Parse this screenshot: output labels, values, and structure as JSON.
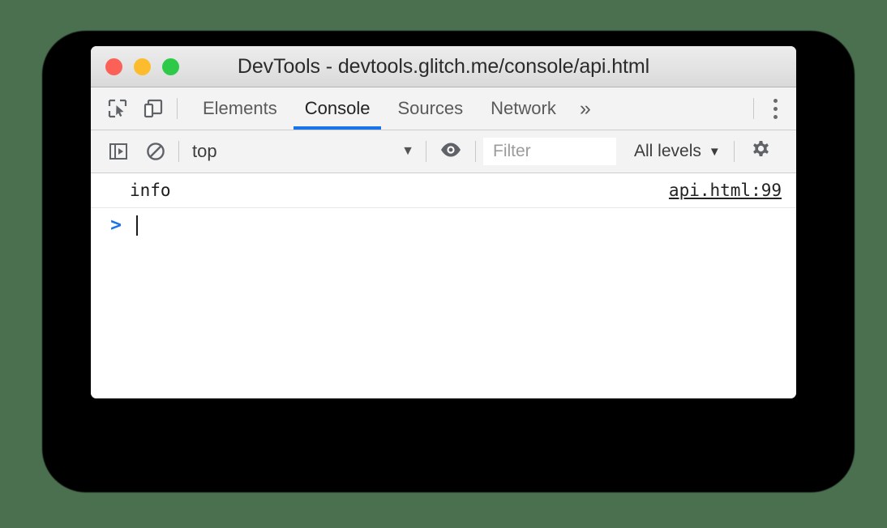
{
  "window": {
    "title": "DevTools - devtools.glitch.me/console/api.html",
    "traffic_lights": [
      {
        "name": "close",
        "color": "#fc6158"
      },
      {
        "name": "minimize",
        "color": "#fdbc2e"
      },
      {
        "name": "maximize",
        "color": "#2fc94a"
      }
    ]
  },
  "tabbar": {
    "icons": [
      {
        "name": "inspect-element-icon"
      },
      {
        "name": "device-toolbar-icon"
      }
    ],
    "tabs": [
      {
        "label": "Elements",
        "active": false
      },
      {
        "label": "Console",
        "active": true
      },
      {
        "label": "Sources",
        "active": false
      },
      {
        "label": "Network",
        "active": false
      }
    ],
    "more_tabs_label": "»",
    "menu_icon": "kebab-menu-icon",
    "active_underline_color": "#1a73e8"
  },
  "console_toolbar": {
    "sidebar_toggle_icon": "show-console-sidebar-icon",
    "clear_console_icon": "clear-console-icon",
    "context": {
      "value": "top",
      "caret": "▼"
    },
    "live_expression_icon": "eye-icon",
    "filter": {
      "value": "",
      "placeholder": "Filter"
    },
    "levels": {
      "label": "All levels",
      "caret": "▼"
    },
    "settings_icon": "gear-icon"
  },
  "console": {
    "messages": [
      {
        "text": "info",
        "source_link": "api.html:99"
      }
    ],
    "prompt": {
      "caret": ">",
      "input_value": ""
    }
  }
}
